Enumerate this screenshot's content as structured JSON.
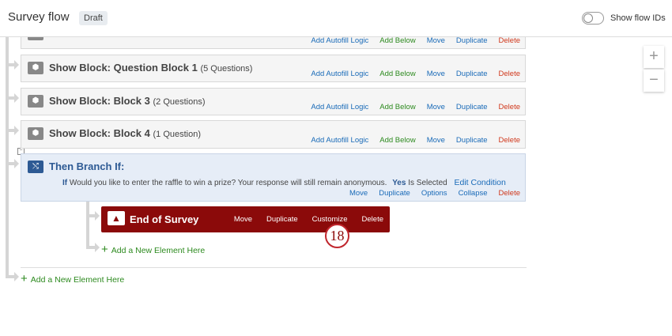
{
  "header": {
    "title": "Survey flow",
    "status_badge": "Draft",
    "toggle_label": "Show flow IDs",
    "toggle_on": false
  },
  "zoom": {
    "zoom_in": "+",
    "zoom_out": "−"
  },
  "block_actions": {
    "autofill": "Add Autofill Logic",
    "add_below": "Add Below",
    "move": "Move",
    "duplicate": "Duplicate",
    "delete": "Delete"
  },
  "blocks": [
    {
      "title": "Show Block: Question Block 1",
      "count": "(5 Questions)"
    },
    {
      "title": "Show Block: Block 3",
      "count": "(2 Questions)"
    },
    {
      "title": "Show Block: Block 4",
      "count": "(1 Question)"
    }
  ],
  "branch": {
    "title": "Then Branch If:",
    "if": "If",
    "question": "Would you like to enter the raffle to win a prize? Your response will still remain anonymous.",
    "answer": "Yes",
    "operator": "Is Selected",
    "edit": "Edit Condition",
    "actions": {
      "move": "Move",
      "duplicate": "Duplicate",
      "options": "Options",
      "collapse": "Collapse",
      "delete": "Delete"
    }
  },
  "end_of_survey": {
    "title": "End of Survey",
    "move": "Move",
    "duplicate": "Duplicate",
    "customize": "Customize",
    "delete": "Delete"
  },
  "step_badge": "18",
  "add_element": "Add a New Element Here",
  "colors": {
    "end_bg": "#8b0a0a",
    "branch_bg": "#e6edf7",
    "branch_title": "#2d5a94",
    "green": "#2d8a1f",
    "blue": "#1a6bb8",
    "red": "#d0391d"
  }
}
